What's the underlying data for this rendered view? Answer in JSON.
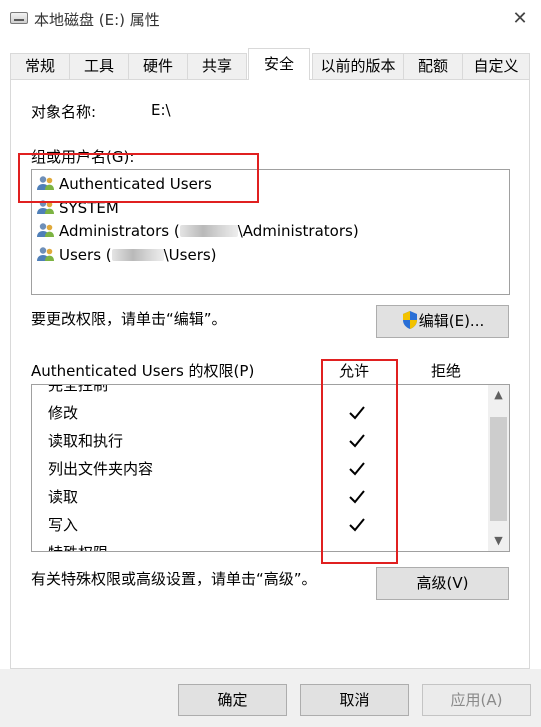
{
  "window": {
    "title": "本地磁盘 (E:) 属性",
    "close_glyph": "✕"
  },
  "tabs": [
    {
      "label": "常规"
    },
    {
      "label": "工具"
    },
    {
      "label": "硬件"
    },
    {
      "label": "共享"
    },
    {
      "label": "安全",
      "active": true
    },
    {
      "label": "以前的版本"
    },
    {
      "label": "配额"
    },
    {
      "label": "自定义"
    }
  ],
  "object": {
    "label": "对象名称:",
    "value": "E:\\"
  },
  "users_section": {
    "label": "组或用户名(G):",
    "users": [
      {
        "name": "Authenticated Users",
        "selected": true
      },
      {
        "name": "SYSTEM"
      },
      {
        "prefix": "Administrators (",
        "suffix": "\\Administrators)"
      },
      {
        "prefix": "Users (",
        "suffix": "\\Users)"
      }
    ]
  },
  "edit_hint": "要更改权限，请单击“编辑”。",
  "edit_button": {
    "label": "编辑(E)...",
    "icon": "uac-shield-icon"
  },
  "permissions": {
    "title": "Authenticated Users 的权限(P)",
    "allow_header": "允许",
    "deny_header": "拒绝",
    "rows": [
      {
        "name": "完全控制",
        "allow": false,
        "deny": false
      },
      {
        "name": "修改",
        "allow": true,
        "deny": false
      },
      {
        "name": "读取和执行",
        "allow": true,
        "deny": false
      },
      {
        "name": "列出文件夹内容",
        "allow": true,
        "deny": false
      },
      {
        "name": "读取",
        "allow": true,
        "deny": false
      },
      {
        "name": "写入",
        "allow": true,
        "deny": false
      },
      {
        "name": "特殊权限",
        "allow": false,
        "deny": false
      }
    ]
  },
  "advanced_hint": "有关特殊权限或高级设置，请单击“高级”。",
  "advanced_button": "高级(V)",
  "footer": {
    "ok": "确定",
    "cancel": "取消",
    "apply": "应用(A)",
    "apply_enabled": false
  },
  "colors": {
    "annotation_red": "#e02020",
    "tab_border": "#d9d9d9",
    "button_face": "#e1e1e1"
  }
}
